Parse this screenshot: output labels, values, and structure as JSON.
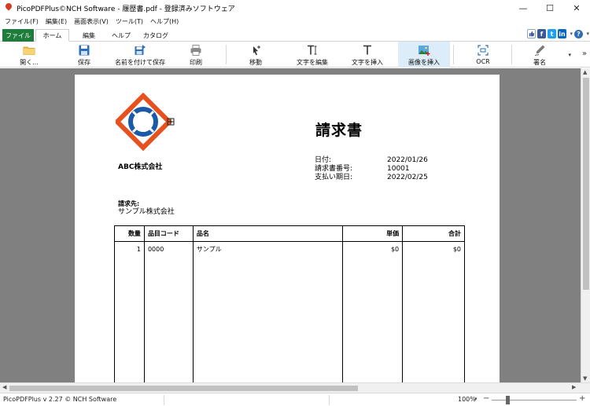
{
  "window": {
    "title": "PicoPDFPlus©NCH Software - 履歴書.pdf - 登録済みソフトウェア",
    "controls": {
      "minimize": "—",
      "maximize": "☐",
      "close": "✕"
    }
  },
  "menubar": {
    "items": [
      "ファイル(F)",
      "編集(E)",
      "画面表示(V)",
      "ツール(T)",
      "ヘルプ(H)"
    ]
  },
  "ribbon_tabs": {
    "file": "ファイル",
    "home": "ホーム",
    "edit": "編集",
    "help": "ヘルプ",
    "catalog": "カタログ"
  },
  "social": {
    "fb": "f",
    "tw": "t",
    "in": "in",
    "help": "?"
  },
  "toolbar": {
    "open": "開く...",
    "save": "保存",
    "save_as": "名前を付けて保存",
    "print": "印刷",
    "move": "移動",
    "edit_text": "文字を編集",
    "insert_text": "文字を挿入",
    "insert_image": "画像を挿入",
    "ocr": "OCR",
    "sign": "署名"
  },
  "document": {
    "company": "ABC株式会社",
    "title": "請求書",
    "meta": [
      {
        "label": "日付:",
        "value": "2022/01/26"
      },
      {
        "label": "請求書番号:",
        "value": "10001"
      },
      {
        "label": "支払い期日:",
        "value": "2022/02/25"
      }
    ],
    "bill_to_label": "請求先:",
    "bill_to_name": "サンプル株式会社",
    "table": {
      "headers": {
        "qty": "数量",
        "code": "品目コード",
        "name": "品名",
        "unit": "単価",
        "total": "合計"
      },
      "rows": [
        {
          "qty": "1",
          "code": "0000",
          "name": "サンプル",
          "unit": "$0",
          "total": "$0"
        }
      ]
    }
  },
  "status": {
    "text": "PicoPDFPlus v 2.27 © NCH Software",
    "zoom": "100%"
  },
  "colors": {
    "file_tab": "#1e7d3a",
    "active_tool": "#dcecf8",
    "viewer_bg": "#808080",
    "logo_orange": "#e8501e",
    "logo_blue": "#1a5aa8"
  }
}
